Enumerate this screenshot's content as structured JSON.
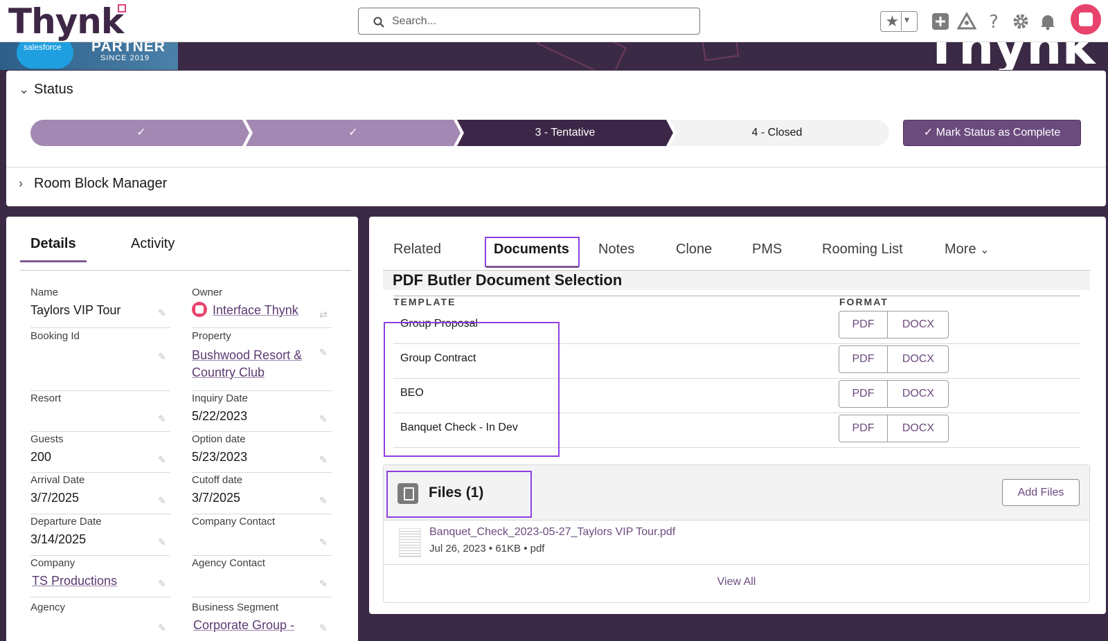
{
  "header": {
    "logo_text": "Thynk",
    "search_placeholder": "Search..."
  },
  "banner": {
    "sf_cloud": "salesforce",
    "partner": "PARTNER",
    "since": "SINCE 2019",
    "brand": "Thynk"
  },
  "status": {
    "title": "Status",
    "stages": [
      {
        "label": "",
        "state": "done"
      },
      {
        "label": "",
        "state": "done"
      },
      {
        "label": "3 - Tentative",
        "state": "current"
      },
      {
        "label": "4 - Closed",
        "state": "todo"
      }
    ],
    "mark_button": "Mark Status as Complete",
    "room_block": "Room Block Manager"
  },
  "left": {
    "tabs": [
      "Details",
      "Activity"
    ],
    "fields": {
      "name_label": "Name",
      "name_value": "Taylors VIP Tour",
      "owner_label": "Owner",
      "owner_value": "Interface Thynk",
      "booking_label": "Booking Id",
      "booking_value": "",
      "property_label": "Property",
      "property_value_1": "Bushwood Resort &",
      "property_value_2": "Country Club",
      "resort_label": "Resort",
      "resort_value": "",
      "inquiry_label": "Inquiry Date",
      "inquiry_value": "5/22/2023",
      "guests_label": "Guests",
      "guests_value": "200",
      "option_label": "Option date",
      "option_value": "5/23/2023",
      "arrival_label": "Arrival Date",
      "arrival_value": "3/7/2025",
      "cutoff_label": "Cutoff date",
      "cutoff_value": "3/7/2025",
      "departure_label": "Departure Date",
      "departure_value": "3/14/2025",
      "company_contact_label": "Company Contact",
      "company_contact_value": "",
      "company_label": "Company",
      "company_value": "TS Productions",
      "agency_contact_label": "Agency Contact",
      "agency_contact_value": "",
      "agency_label": "Agency",
      "agency_value": "",
      "segment_label": "Business Segment",
      "segment_value": "Corporate Group -"
    }
  },
  "right": {
    "tabs": [
      "Related",
      "Documents",
      "Notes",
      "Clone",
      "PMS",
      "Rooming List",
      "More"
    ],
    "pdf_title": "PDF Butler Document Selection",
    "col_template": "TEMPLATE",
    "col_format": "FORMAT",
    "templates": [
      "Group Proposal",
      "Group Contract",
      "BEO",
      "Banquet Check - In Dev"
    ],
    "fmt_pdf": "PDF",
    "fmt_docx": "DOCX",
    "files_title": "Files (1)",
    "add_files": "Add Files",
    "file_name": "Banquet_Check_2023-05-27_Taylors VIP Tour.pdf",
    "file_date": "Jul 26, 2023",
    "file_size": "61KB",
    "file_type": "pdf",
    "view_all": "View All"
  },
  "colors": {
    "accent": "#6b4a7e",
    "stage_done": "#a388b3",
    "stage_current": "#3d2748",
    "highlight_box": "#8f3fe0",
    "brand_pink": "#e8436c"
  }
}
